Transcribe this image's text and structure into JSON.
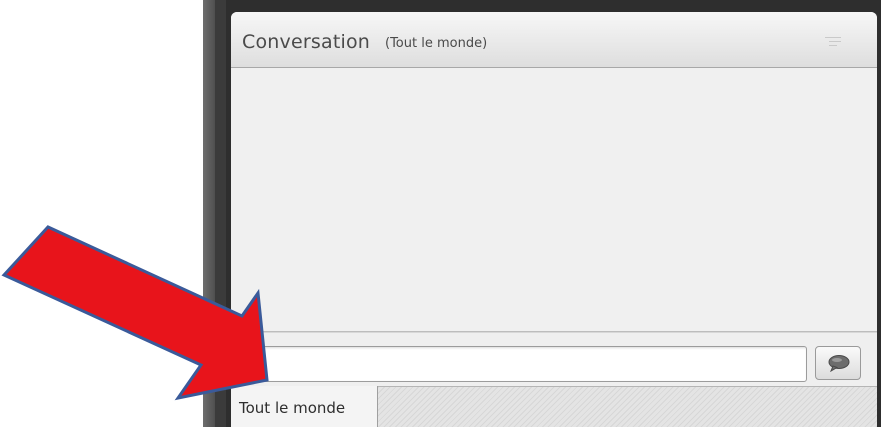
{
  "pod": {
    "title": "Conversation",
    "subtitle": "(Tout le monde)",
    "menu_icon": "menu-lines-icon"
  },
  "composer": {
    "input_value": "",
    "input_placeholder": "",
    "send_icon": "speech-bubble-icon"
  },
  "tabs": [
    {
      "label": "Tout le monde",
      "selected": true
    }
  ],
  "annotation": {
    "arrow_icon": "pointer-arrow-icon",
    "arrow_color": "#e8141b",
    "arrow_outline_color": "#3a5a9a"
  }
}
